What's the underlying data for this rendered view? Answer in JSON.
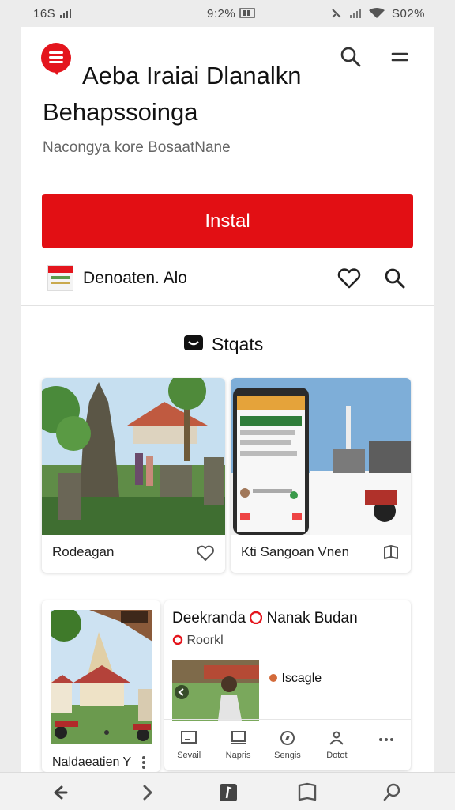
{
  "status_bar": {
    "left": "16S",
    "center": "9:2%",
    "right": "S02%"
  },
  "header": {
    "title_line1": "Aeba Iraiai Dlanalkn",
    "title_line2": "Behapssoinga",
    "subtitle": "Nacongya kore BosaatNane"
  },
  "install": {
    "label": "Instal"
  },
  "developer": {
    "name": "Denoaten. Alo"
  },
  "section": {
    "title": "Stqats"
  },
  "cards": {
    "card1": {
      "label": "Rodeagan"
    },
    "card2": {
      "label": "Kti Sangoan Vnen"
    },
    "card3": {
      "caption": "Naldaeatien Y"
    },
    "card4": {
      "title": "Deekranda",
      "title_tail": "Nanak Budan",
      "tag": "Roorkl",
      "app_label": "Iscagle",
      "tabs": [
        "Sevail",
        "Napris",
        "Sengis",
        "Dotot"
      ]
    }
  },
  "colors": {
    "accent": "#e20f14",
    "background": "#ffffff"
  }
}
